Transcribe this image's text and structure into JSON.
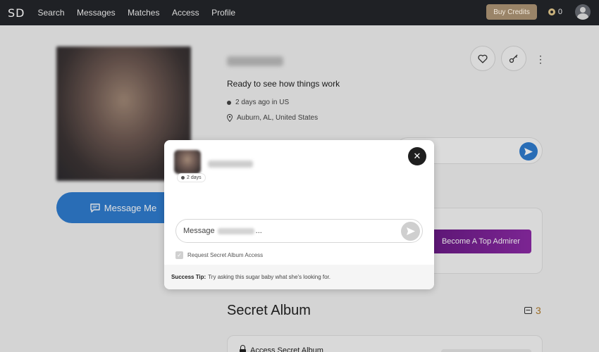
{
  "nav": {
    "logo": "SD",
    "links": [
      "Search",
      "Messages",
      "Matches",
      "Access",
      "Profile"
    ],
    "buy_credits": "Buy Credits",
    "credits": "0"
  },
  "profile": {
    "tagline": "Ready to see how things work",
    "last_active": "2 days ago in US",
    "location": "Auburn, AL, United States",
    "message_me": "Message Me",
    "admirer_button": "Become A Top Admirer",
    "secret_album_title": "Secret Album",
    "secret_album_count": "3",
    "access_secret_album": "Access Secret Album"
  },
  "modal": {
    "status": "2 days",
    "message_prefix": "Message",
    "message_suffix": "...",
    "request_access": "Request Secret Album Access",
    "tip_label": "Success Tip:",
    "tip_text": "Try asking this sugar baby what she's looking for."
  },
  "icons": {
    "close": "close-icon",
    "send": "send-icon",
    "heart": "heart-icon",
    "key": "key-icon",
    "more": "more-vertical-icon"
  },
  "colors": {
    "nav_bg": "#1f2125",
    "primary_blue": "#2f7dd0",
    "buy_credits": "#9a8468",
    "admirer_purple": "#7a2296",
    "album_count": "#b17a2a"
  }
}
